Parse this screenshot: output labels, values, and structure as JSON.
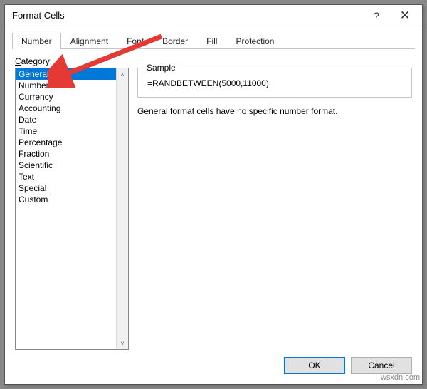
{
  "window": {
    "title": "Format Cells"
  },
  "tabs": [
    {
      "label": "Number",
      "active": true
    },
    {
      "label": "Alignment"
    },
    {
      "label": "Font"
    },
    {
      "label": "Border"
    },
    {
      "label": "Fill"
    },
    {
      "label": "Protection"
    }
  ],
  "category": {
    "label_prefix": "C",
    "label_rest": "ategory:",
    "items": [
      {
        "label": "General",
        "selected": true
      },
      {
        "label": "Number"
      },
      {
        "label": "Currency"
      },
      {
        "label": "Accounting"
      },
      {
        "label": "Date"
      },
      {
        "label": "Time"
      },
      {
        "label": "Percentage"
      },
      {
        "label": "Fraction"
      },
      {
        "label": "Scientific"
      },
      {
        "label": "Text"
      },
      {
        "label": "Special"
      },
      {
        "label": "Custom"
      }
    ]
  },
  "sample": {
    "legend": "Sample",
    "value": "=RANDBETWEEN(5000,11000)"
  },
  "description": "General format cells have no specific number format.",
  "buttons": {
    "ok": "OK",
    "cancel": "Cancel"
  },
  "watermark": "wsxdn.com",
  "icons": {
    "help": "?",
    "close": "✕",
    "scroll_up": "˄",
    "scroll_down": "˅"
  },
  "annotation": {
    "arrow_color": "#e53935"
  }
}
